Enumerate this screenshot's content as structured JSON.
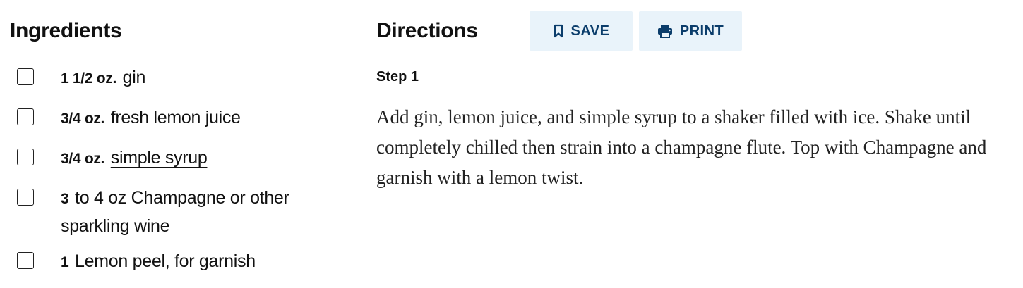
{
  "ingredients": {
    "title": "Ingredients",
    "items": [
      {
        "qty": "1 1/2 oz.",
        "text": "gin",
        "is_link": false
      },
      {
        "qty": "3/4 oz.",
        "text": "fresh lemon juice",
        "is_link": false
      },
      {
        "qty": "3/4 oz.",
        "text": "simple syrup",
        "is_link": true
      },
      {
        "qty": "3",
        "text": "to 4 oz Champagne or other sparkling wine",
        "is_link": false
      },
      {
        "qty": "1",
        "text": "Lemon peel, for garnish",
        "is_link": false
      }
    ]
  },
  "directions": {
    "title": "Directions",
    "save_label": "SAVE",
    "print_label": "PRINT",
    "steps": [
      {
        "label": "Step 1",
        "text": "Add gin, lemon juice, and simple syrup to a shaker filled with ice. Shake until completely chilled then strain into a champagne flute. Top with Champagne and garnish with a lemon twist."
      }
    ]
  },
  "icons": {
    "save": "bookmark-icon",
    "print": "printer-icon"
  },
  "colors": {
    "button_bg": "#e9f3fa",
    "button_text": "#0b3d6b",
    "text": "#111111"
  }
}
